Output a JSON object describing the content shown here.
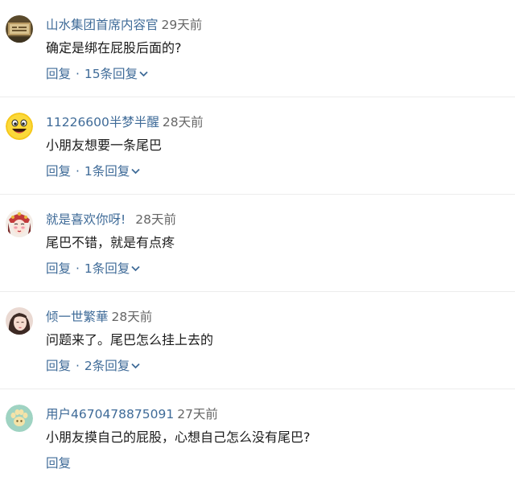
{
  "comments": [
    {
      "username": "山水集团首席内容官",
      "time": "29天前",
      "content": "确定是绑在屁股后面的?",
      "reply_label": "回复",
      "separator": "·",
      "replies_label": "15条回复",
      "avatar": "photo-avatar-icon"
    },
    {
      "username": "11226600半梦半醒",
      "time": "28天前",
      "content": "小朋友想要一条尾巴",
      "reply_label": "回复",
      "separator": "·",
      "replies_label": "1条回复",
      "avatar": "smiley-face-icon"
    },
    {
      "username": "就是喜欢你呀!",
      "time": "28天前",
      "content": "尾巴不错，就是有点疼",
      "reply_label": "回复",
      "separator": "·",
      "replies_label": "1条回复",
      "avatar": "opera-character-icon"
    },
    {
      "username": "倾一世繁華",
      "time": "28天前",
      "content": "问题来了。尾巴怎么挂上去的",
      "reply_label": "回复",
      "separator": "·",
      "replies_label": "2条回复",
      "avatar": "portrait-avatar-icon"
    },
    {
      "username": "用户4670478875091",
      "time": "27天前",
      "content": "小朋友摸自己的屁股，心想自己怎么没有尾巴?",
      "reply_label": "回复",
      "avatar": "paw-avatar-icon"
    }
  ],
  "colors": {
    "link": "#3f6b98",
    "text": "#1a1a1a",
    "muted": "#666666",
    "divider": "#ececec"
  }
}
